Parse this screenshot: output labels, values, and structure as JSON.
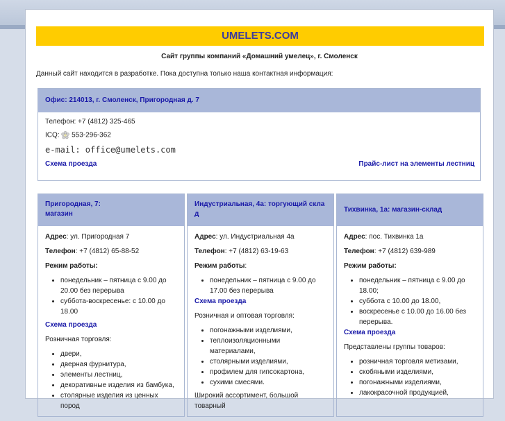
{
  "site": {
    "banner": "UMELETS.COM",
    "subtitle": "Сайт группы компаний «Домашний умелец», г. Смоленск",
    "notice": "Данный сайт находится в разработке. Пока доступна только наша контактная информация:"
  },
  "office": {
    "title": "Офис: 214013, г. Смоленск, Пригородная д. 7",
    "phone": "Телефон: +7 (4812) 325-465",
    "icq_prefix": "ICQ:",
    "icq": "553-296-362",
    "email": "e-mail: office@umelets.com",
    "map_link": "Схема проезда",
    "price_link": "Прайс-лист на элементы лестниц"
  },
  "stores": [
    {
      "title_line1": "Пригородная, 7:",
      "title_line2": "магазин",
      "address_label": "Адрес",
      "address": ": ул. Пригородная 7",
      "phone_label": "Телефон",
      "phone": ": +7 (4812) 65-88-52",
      "hours_label": "Режим работы:",
      "hours_suffix": "",
      "hours": [
        "понедельник – пятница с 9.00 до 20.00 без перерыва",
        "суббота-воскресенье: с 10.00 до 18.00"
      ],
      "map_link": "Схема проезда",
      "desc": "Розничная торговля:",
      "items": [
        "двери,",
        "дверная фурнитура,",
        "элементы лестниц,",
        "декоративные изделия из бамбука,",
        "столярные изделия из ценных пород"
      ]
    },
    {
      "title_line1": "Индустриальная, 4а: торгующий скла",
      "title_line2": "д",
      "address_label": "Адрес",
      "address": ": ул. Индустриальная 4а",
      "phone_label": "Телефон",
      "phone": ": +7 (4812) 63-19-63",
      "hours_label": "Режим работы",
      "hours_suffix": ":",
      "hours": [
        "понедельник – пятница с 9.00 до 17.00 без перерыва"
      ],
      "map_link": "Схема проезда",
      "desc": "Розничная и оптовая торговля:",
      "items": [
        "погонажными изделиями,",
        "теплоизоляционными материалами,",
        "столярными изделиями,",
        "профилем для гипсокартона,",
        "сухими смесями."
      ],
      "extra": "Широкий ассортимент, большой товарный"
    },
    {
      "title_line1": "Тихвинка, 1а: магазин-склад",
      "title_line2": "",
      "address_label": "Адрес",
      "address": ": пос. Тихвинка 1а",
      "phone_label": "Телефон",
      "phone": ": +7 (4812) 639-989",
      "hours_label": "Режим работы:",
      "hours_suffix": "",
      "hours": [
        "понедельник – пятница с 9.00 до 18.00;",
        "суббота с 10.00 до 18.00,",
        "воскресенье с 10.00 до 16.00 без перерыва."
      ],
      "map_link": "Схема проезда",
      "desc": "Представлены группы товаров:",
      "items": [
        "розничная торговля метизами,",
        "скобяными изделиями,",
        "погонажными изделиями,",
        "лакокрасочной продукцией,"
      ]
    }
  ],
  "colors": {
    "banner_bg": "#ffcc00",
    "banner_text": "#3b3b9f",
    "header_bg": "#a9b7d9",
    "link": "#1a1aa8"
  }
}
